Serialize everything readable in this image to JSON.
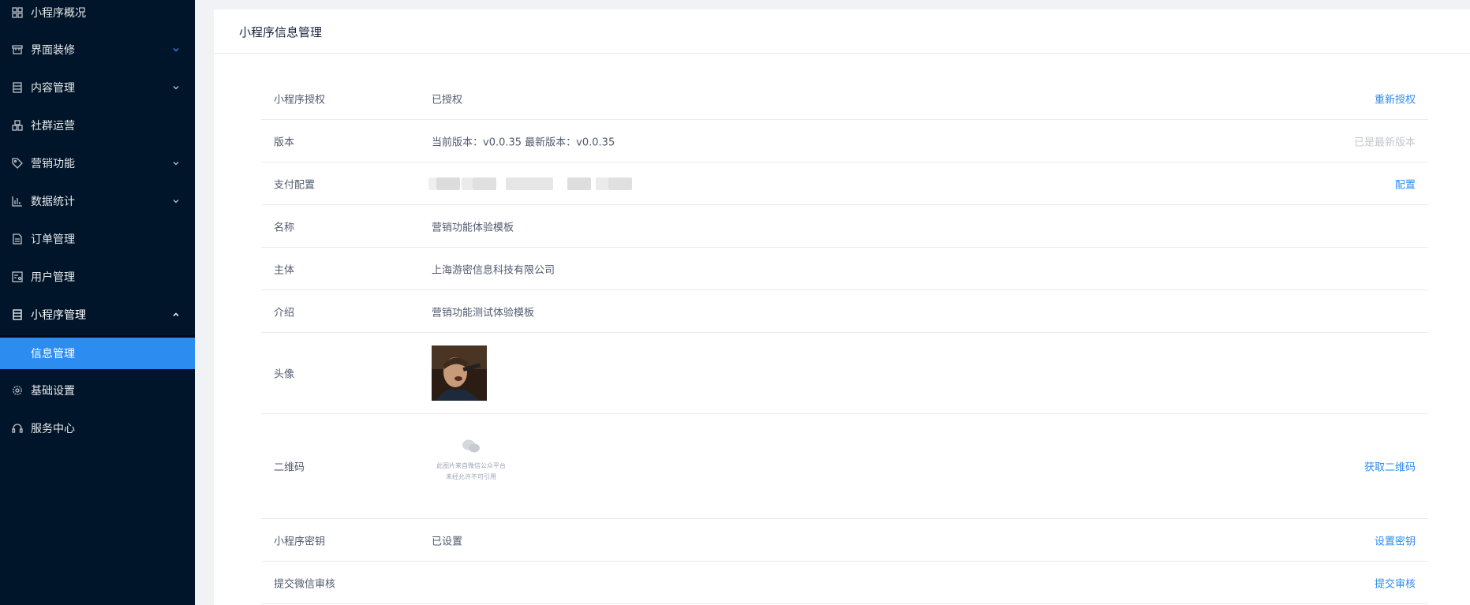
{
  "sidebar": {
    "items": [
      {
        "label": "小程序概况",
        "icon": "grid-icon",
        "chevron": ""
      },
      {
        "label": "界面装修",
        "icon": "shop-icon",
        "chevron": "down"
      },
      {
        "label": "内容管理",
        "icon": "document-icon",
        "chevron": "down"
      },
      {
        "label": "社群运营",
        "icon": "community-icon",
        "chevron": ""
      },
      {
        "label": "营销功能",
        "icon": "tag-icon",
        "chevron": "down"
      },
      {
        "label": "数据统计",
        "icon": "bar-chart-icon",
        "chevron": "down"
      },
      {
        "label": "订单管理",
        "icon": "file-icon",
        "chevron": ""
      },
      {
        "label": "用户管理",
        "icon": "user-card-icon",
        "chevron": ""
      },
      {
        "label": "小程序管理",
        "icon": "document-icon",
        "chevron": "up"
      },
      {
        "label": "基础设置",
        "icon": "gear-icon",
        "chevron": ""
      },
      {
        "label": "服务中心",
        "icon": "headset-icon",
        "chevron": ""
      }
    ],
    "sub_item": {
      "label": "信息管理"
    }
  },
  "main": {
    "title": "小程序信息管理",
    "rows": {
      "auth": {
        "label": "小程序授权",
        "value": "已授权",
        "action": "重新授权"
      },
      "version": {
        "label": "版本",
        "value": "当前版本：v0.0.35  最新版本：v0.0.35",
        "action": "已是最新版本"
      },
      "payment": {
        "label": "支付配置",
        "action": "配置"
      },
      "name": {
        "label": "名称",
        "value": "营销功能体验模板"
      },
      "entity": {
        "label": "主体",
        "value": "上海游密信息科技有限公司"
      },
      "intro": {
        "label": "介绍",
        "value": "营销功能测试体验模板"
      },
      "avatar": {
        "label": "头像"
      },
      "qrcode": {
        "label": "二维码",
        "placeholder_line1": "此图片来自微信公众平台",
        "placeholder_line2": "未经允许不可引用",
        "action": "获取二维码"
      },
      "secret": {
        "label": "小程序密钥",
        "value": "已设置",
        "action": "设置密钥"
      },
      "review": {
        "label": "提交微信审核",
        "action": "提交审核"
      }
    }
  },
  "colors": {
    "sidebar_bg": "#001529",
    "accent": "#2d8cf0",
    "disabled": "#c5c8ce"
  }
}
